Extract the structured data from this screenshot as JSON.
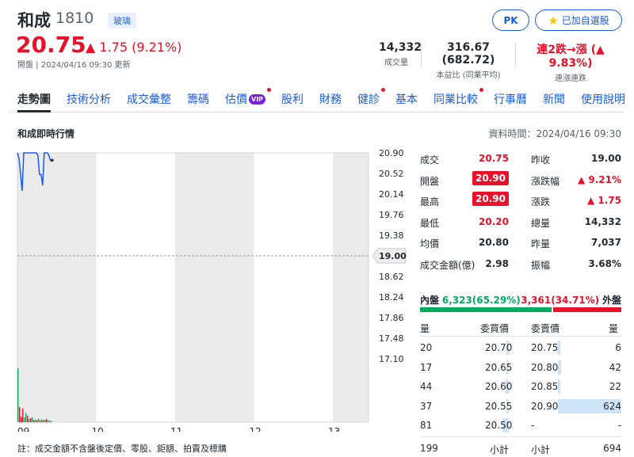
{
  "header": {
    "name": "和成",
    "code": "1810",
    "industry": "玻璃",
    "pk_label": "PK",
    "watchlist_label": "已加自選股",
    "price": "20.75",
    "change": "▲ 1.75 (9.21%)",
    "meta": "開盤 | 2024/04/16 09:30 更新",
    "stats": [
      {
        "value": "14,332",
        "label": "成交量"
      },
      {
        "value": "316.67 (682.72)",
        "label": "本益比 (同業平均)"
      },
      {
        "value": "連2跌→漲 (▲ 9.83%)",
        "label": "連漲連跌"
      }
    ]
  },
  "tabs": [
    {
      "label": "走勢圖",
      "active": true
    },
    {
      "label": "技術分析"
    },
    {
      "label": "成交彙整"
    },
    {
      "label": "籌碼"
    },
    {
      "label": "估價",
      "vip": "VIP",
      "dot": true
    },
    {
      "label": "股利"
    },
    {
      "label": "財務"
    },
    {
      "label": "健診",
      "dot": true
    },
    {
      "label": "基本"
    },
    {
      "label": "同業比較",
      "dot": true
    },
    {
      "label": "行事曆"
    },
    {
      "label": "新聞"
    },
    {
      "label": "使用說明"
    }
  ],
  "section": {
    "title": "和成即時行情",
    "data_time": "資料時間：2024/04/16 09:30"
  },
  "chart_data": {
    "type": "line",
    "x_ticks": [
      "09",
      "10",
      "11",
      "12",
      "13"
    ],
    "y_ticks": [
      "20.90",
      "20.52",
      "20.14",
      "19.76",
      "19.38",
      "19.00",
      "18.62",
      "18.24",
      "17.86",
      "17.48",
      "17.10"
    ],
    "reference_price": 19.0,
    "ylim": [
      17.1,
      20.9
    ],
    "x_hours": [
      9.0,
      9.02,
      9.04,
      9.06,
      9.08,
      9.1,
      9.12,
      9.14,
      9.16,
      9.18,
      9.2,
      9.22,
      9.24,
      9.26,
      9.28,
      9.3,
      9.32,
      9.34,
      9.36,
      9.38,
      9.4,
      9.42
    ],
    "price": [
      20.9,
      20.8,
      20.5,
      20.2,
      20.9,
      20.9,
      20.9,
      20.9,
      20.9,
      20.9,
      20.9,
      20.9,
      20.9,
      20.85,
      20.5,
      20.5,
      20.3,
      20.9,
      20.9,
      20.9,
      20.85,
      20.75
    ],
    "volume": [
      1500,
      420,
      150,
      380,
      130,
      250,
      180,
      90,
      110,
      140,
      60,
      70,
      55,
      95,
      45,
      80,
      55,
      65,
      90,
      60,
      30,
      40
    ],
    "volume_dir": [
      "up",
      "dn",
      "dn",
      "dn",
      "up",
      "up",
      "dn",
      "up",
      "dn",
      "up",
      "dn",
      "up",
      "dn",
      "up",
      "dn",
      "up",
      "dn",
      "up",
      "dn",
      "up",
      "dn",
      "up"
    ],
    "colors": {
      "line": "#1a5ae8",
      "up": "#eb0f29",
      "down": "#00ab5e"
    }
  },
  "quote": {
    "rows": [
      {
        "l1": "成交",
        "v1": "20.75",
        "c1": "up",
        "l2": "昨收",
        "v2": "19.00",
        "c2": ""
      },
      {
        "l1": "開盤",
        "v1": "20.90",
        "c1": "badge",
        "l2": "漲跌幅",
        "v2": "▲ 9.21%",
        "c2": "up"
      },
      {
        "l1": "最高",
        "v1": "20.90",
        "c1": "badge",
        "l2": "漲跌",
        "v2": "▲ 1.75",
        "c2": "up"
      },
      {
        "l1": "最低",
        "v1": "20.20",
        "c1": "up",
        "l2": "總量",
        "v2": "14,332",
        "c2": ""
      },
      {
        "l1": "均價",
        "v1": "20.80",
        "c1": "",
        "l2": "昨量",
        "v2": "7,037",
        "c2": ""
      },
      {
        "l1": "成交金額(億)",
        "v1": "2.98",
        "c1": "",
        "l2": "振幅",
        "v2": "3.68%",
        "c2": ""
      }
    ],
    "flow": {
      "inner_label": "內盤",
      "inner_value": "6,323(65.29%)",
      "outer_value": "3,361(34.71%)",
      "outer_label": "外盤",
      "inner_pct": 65.29
    }
  },
  "orderbook": {
    "headers": {
      "bid_qty": "量",
      "bid_price": "委買價",
      "ask_price": "委賣價",
      "ask_qty": "量"
    },
    "rows": [
      {
        "bq": "20",
        "bp": "20.70",
        "ap": "20.75",
        "aq": "6",
        "bid_frac": 0.06,
        "ask_frac": 0.02
      },
      {
        "bq": "17",
        "bp": "20.65",
        "ap": "20.80",
        "aq": "42",
        "bid_frac": 0.05,
        "ask_frac": 0.05
      },
      {
        "bq": "44",
        "bp": "20.60",
        "ap": "20.85",
        "aq": "22",
        "bid_frac": 0.11,
        "ask_frac": 0.03
      },
      {
        "bq": "37",
        "bp": "20.55",
        "ap": "20.90",
        "aq": "624",
        "bid_frac": 0.09,
        "ask_frac": 1.0
      },
      {
        "bq": "81",
        "bp": "20.50",
        "ap": "-",
        "aq": "-",
        "bid_frac": 0.2,
        "ask_frac": 0
      }
    ],
    "totals": {
      "bid_total": "199",
      "bid_label": "小計",
      "ask_label": "小計",
      "ask_total": "694"
    }
  },
  "footnote": "註：成交金額不含盤後定價、零股、鉅額、拍賣及標購"
}
